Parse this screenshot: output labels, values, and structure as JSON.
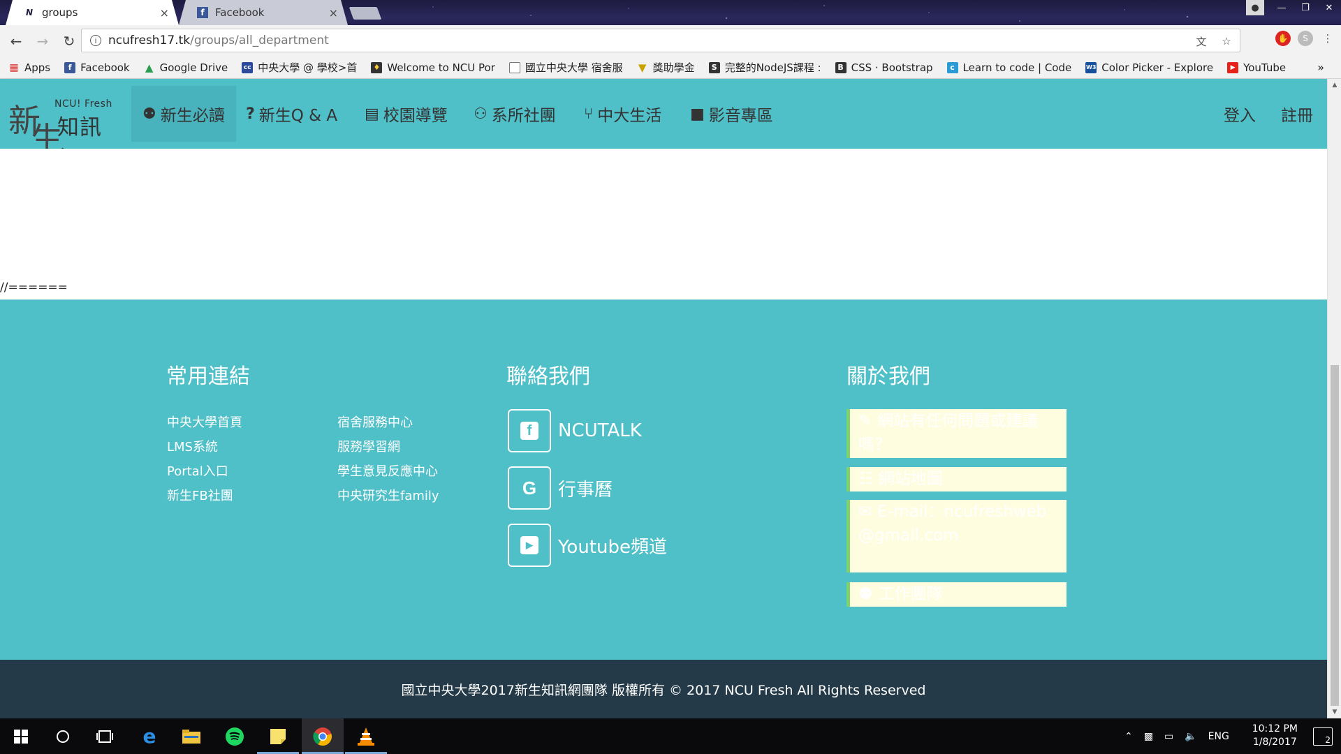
{
  "browser": {
    "tabs": [
      {
        "title": "groups",
        "favicon": "N",
        "active": true
      },
      {
        "title": "Facebook",
        "favicon": "f",
        "active": false
      }
    ],
    "url_host": "ncufresh17.tk",
    "url_path": "/groups/all_department",
    "bookmarks": [
      {
        "label": "Apps",
        "icon": "apps-grid-icon",
        "color": "#e44"
      },
      {
        "label": "Facebook",
        "icon": "facebook-icon",
        "color": "#3b5998"
      },
      {
        "label": "Google Drive",
        "icon": "drive-icon",
        "color": "#2a9d50"
      },
      {
        "label": "中央大學 @ 學校>首",
        "icon": "cc-icon",
        "color": "#2b4a9c"
      },
      {
        "label": "Welcome to NCU Por",
        "icon": "shield-icon",
        "color": "#333"
      },
      {
        "label": "國立中央大學 宿舍服",
        "icon": "page-icon",
        "color": "#777"
      },
      {
        "label": "獎助學金",
        "icon": "crest-icon",
        "color": "#c9a100"
      },
      {
        "label": "完整的NodeJS課程 :",
        "icon": "s-icon",
        "color": "#333"
      },
      {
        "label": "CSS · Bootstrap",
        "icon": "bootstrap-icon",
        "color": "#333"
      },
      {
        "label": "Learn to code | Code",
        "icon": "codecademy-icon",
        "color": "#2a9bd6"
      },
      {
        "label": "Color Picker - Explore",
        "icon": "w3schools-icon",
        "color": "#1a4f9c"
      },
      {
        "label": "YouTube",
        "icon": "youtube-icon",
        "color": "#e62117"
      }
    ],
    "bookmarks_more": "»"
  },
  "site": {
    "logo_en": "NCU! Fresh",
    "logo_big1": "新",
    "logo_big2": "生",
    "logo_cn": "知訊網",
    "nav": [
      {
        "label": "新生必讀",
        "icon": "map-marker-icon",
        "glyph": "⚉",
        "active": true
      },
      {
        "label": "新生Q & A",
        "icon": "question-icon",
        "glyph": "?",
        "active": false
      },
      {
        "label": "校園導覽",
        "icon": "map-icon",
        "glyph": "▤",
        "active": false
      },
      {
        "label": "系所社團",
        "icon": "users-icon",
        "glyph": "⚇",
        "active": false
      },
      {
        "label": "中大生活",
        "icon": "cutlery-icon",
        "glyph": "⑂",
        "active": false
      },
      {
        "label": "影音專區",
        "icon": "video-camera-icon",
        "glyph": "■",
        "active": false
      }
    ],
    "login": "登入",
    "register": "註冊"
  },
  "content": {
    "comment_text": "//======"
  },
  "footer": {
    "links_heading": "常用連結",
    "contact_heading": "聯絡我們",
    "about_heading": "關於我們",
    "links_col1": [
      "中央大學首頁",
      "LMS系統",
      "Portal入口",
      "新生FB社團"
    ],
    "links_col2": [
      "宿舍服務中心",
      "服務學習網",
      "學生意見反應中心",
      "中央研究生family"
    ],
    "social": [
      {
        "label": "NCUTALK",
        "icon": "facebook-icon",
        "glyph": "f"
      },
      {
        "label": "行事曆",
        "icon": "google-icon",
        "glyph": "G"
      },
      {
        "label": "Youtube頻道",
        "icon": "youtube-icon",
        "glyph": "▶"
      }
    ],
    "about": [
      {
        "text": "網站有任何問題或建議嗎？",
        "icon": "edit-icon",
        "glyph": "✎"
      },
      {
        "text": "網站地圖",
        "icon": "sitemap-icon",
        "glyph": "☷"
      },
      {
        "text": "E-mail：ncufreshweb@gmail.com",
        "icon": "envelope-icon",
        "glyph": "✉"
      },
      {
        "text": "工作團隊",
        "icon": "team-icon",
        "glyph": "⚉"
      }
    ],
    "copyright": "國立中央大學2017新生知訊網團隊 版權所有 © 2017 NCU Fresh All Rights Reserved"
  },
  "taskbar": {
    "language": "ENG",
    "time": "10:12 PM",
    "date": "1/8/2017",
    "notifications": "2"
  }
}
